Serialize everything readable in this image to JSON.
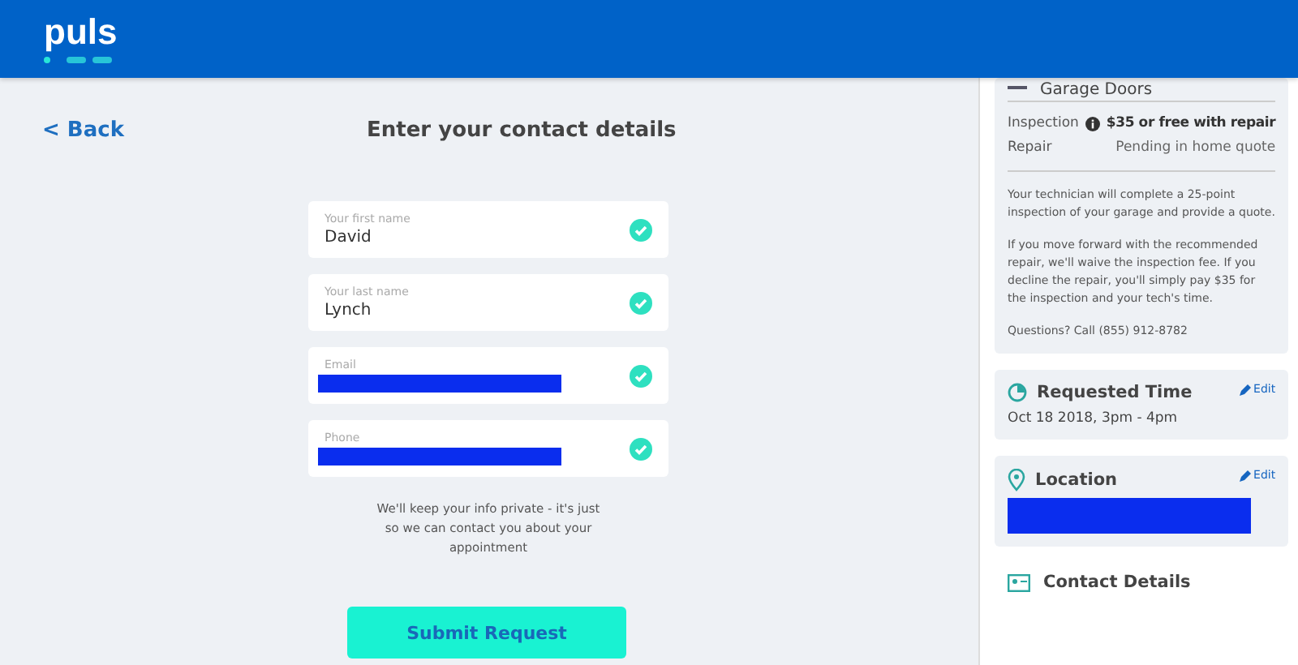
{
  "header": {
    "logo": "puls"
  },
  "back": {
    "label": "Back",
    "arrow": "<"
  },
  "title": "Enter your contact details",
  "fields": [
    {
      "label": "Your first name",
      "kind": "text",
      "value": "David",
      "valid": true
    },
    {
      "label": "Your last name",
      "kind": "text",
      "value": "Lynch",
      "valid": true
    },
    {
      "label": "Email",
      "kind": "redacted",
      "valid": true
    },
    {
      "label": "Phone",
      "kind": "redacted",
      "valid": true
    }
  ],
  "privacy_note": "We'll keep your info private - it's just so we can contact you about your appointment",
  "submit": "Submit Request",
  "summary": {
    "service": "Garage Doors",
    "prices": [
      {
        "label": "Inspection",
        "info": true,
        "value": "$35 or free with repair",
        "bold": true
      },
      {
        "label": "Repair",
        "info": false,
        "value": "Pending in home quote",
        "bold": false
      }
    ],
    "paragraphs": [
      "Your technician will complete a 25-point inspection of your garage and provide a quote.",
      "If you move forward with the recommended repair, we'll waive the inspection fee. If you decline the repair, you'll simply pay $35 for the inspection and your tech's time.",
      "Questions? Call (855) 912-8782"
    ],
    "cards": [
      {
        "kind": "time",
        "title": "Requested Time",
        "edit": "Edit",
        "value": "Oct 18 2018, 3pm - 4pm"
      },
      {
        "kind": "location",
        "title": "Location",
        "edit": "Edit",
        "redacted": true
      }
    ],
    "contact": {
      "title": "Contact Details"
    }
  }
}
